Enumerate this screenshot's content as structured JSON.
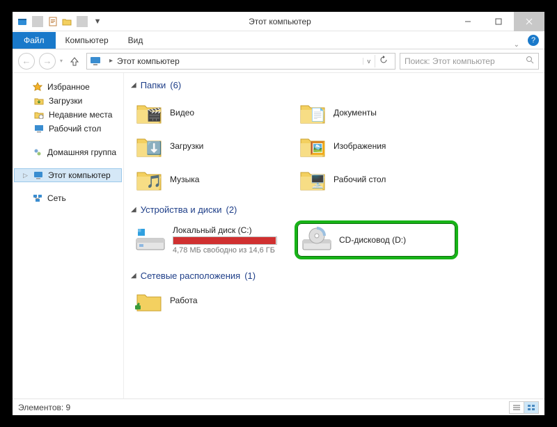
{
  "window": {
    "title": "Этот компьютер"
  },
  "ribbon": {
    "file": "Файл",
    "tabs": [
      "Компьютер",
      "Вид"
    ]
  },
  "address": {
    "crumb_root": "Этот компьютер",
    "search_placeholder": "Поиск: Этот компьютер"
  },
  "nav": {
    "favorites": "Избранное",
    "fav_items": [
      "Загрузки",
      "Недавние места",
      "Рабочий стол"
    ],
    "homegroup": "Домашняя группа",
    "this_pc": "Этот компьютер",
    "network": "Сеть"
  },
  "groups": {
    "folders_title": "Папки",
    "folders_count": "(6)",
    "devices_title": "Устройства и диски",
    "devices_count": "(2)",
    "net_title": "Сетевые расположения",
    "net_count": "(1)"
  },
  "folders": [
    {
      "label": "Видео",
      "emoji": "🎬"
    },
    {
      "label": "Документы",
      "emoji": "📄"
    },
    {
      "label": "Загрузки",
      "emoji": "⬇️"
    },
    {
      "label": "Изображения",
      "emoji": "🖼️"
    },
    {
      "label": "Музыка",
      "emoji": "🎵"
    },
    {
      "label": "Рабочий стол",
      "emoji": "🖥️"
    }
  ],
  "devices": {
    "c_label": "Локальный диск (C:)",
    "c_sub": "4,78 МБ свободно из 14,6 ГБ",
    "c_fill_percent": 99,
    "d_label": "CD-дисковод (D:)"
  },
  "net_locations": {
    "work": "Работа"
  },
  "status": {
    "items_label": "Элементов:",
    "items_count": "9"
  }
}
